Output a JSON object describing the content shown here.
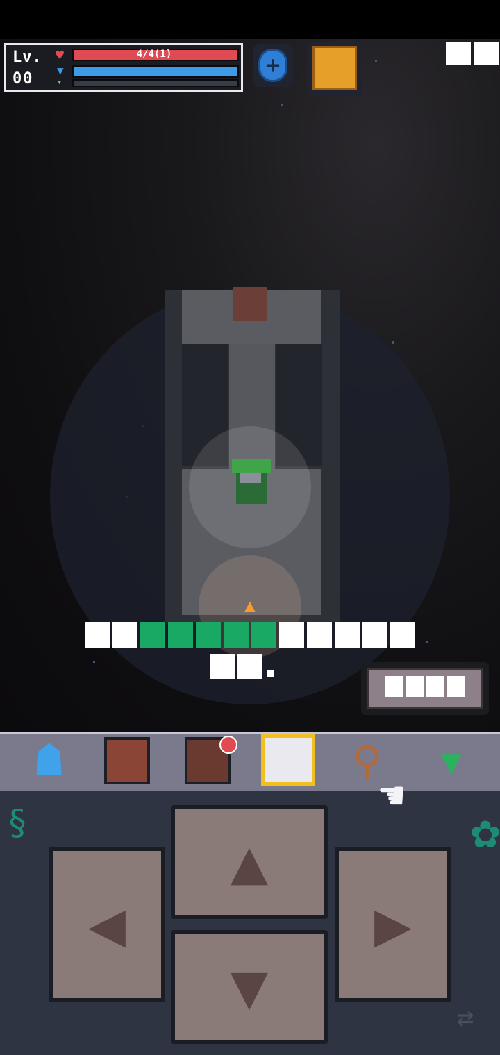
{
  "status": {
    "level_label": "Lv.",
    "level_value": "00",
    "hp_text": "4/4(1)",
    "hp_fraction": 1.0,
    "mp_fraction": 1.0,
    "xp_fraction": 0.0,
    "hp_color": "#e04b53",
    "mp_color": "#3e9be6"
  },
  "icons": {
    "heart": "heart-icon",
    "drop": "mana-icon",
    "plus": "plus-icon",
    "stats": "leaderboard-icon",
    "character": "character-icon",
    "book": "journal-icon",
    "bag": "backpack-icon",
    "map": "map-icon",
    "search": "search-icon",
    "toggle": "collapse-icon",
    "swap": "swap-icon"
  },
  "glyphs": {
    "top_right": [
      "",
      ""
    ],
    "message_line1": [
      "",
      "",
      "",
      "",
      "",
      "",
      "",
      "",
      "",
      "",
      "",
      ""
    ],
    "message_line1_highlight": [
      2,
      3,
      4,
      5,
      6
    ],
    "message_line2": [
      "",
      ""
    ],
    "message_line2_suffix": ".",
    "mini_widget": [
      "",
      "",
      "",
      ""
    ]
  },
  "controls": {
    "up": "up",
    "down": "down",
    "left": "left",
    "right": "right"
  },
  "colors": {
    "accent_gold": "#f0c020",
    "message_highlight": "#1aa865",
    "notification": "#e04b53"
  }
}
